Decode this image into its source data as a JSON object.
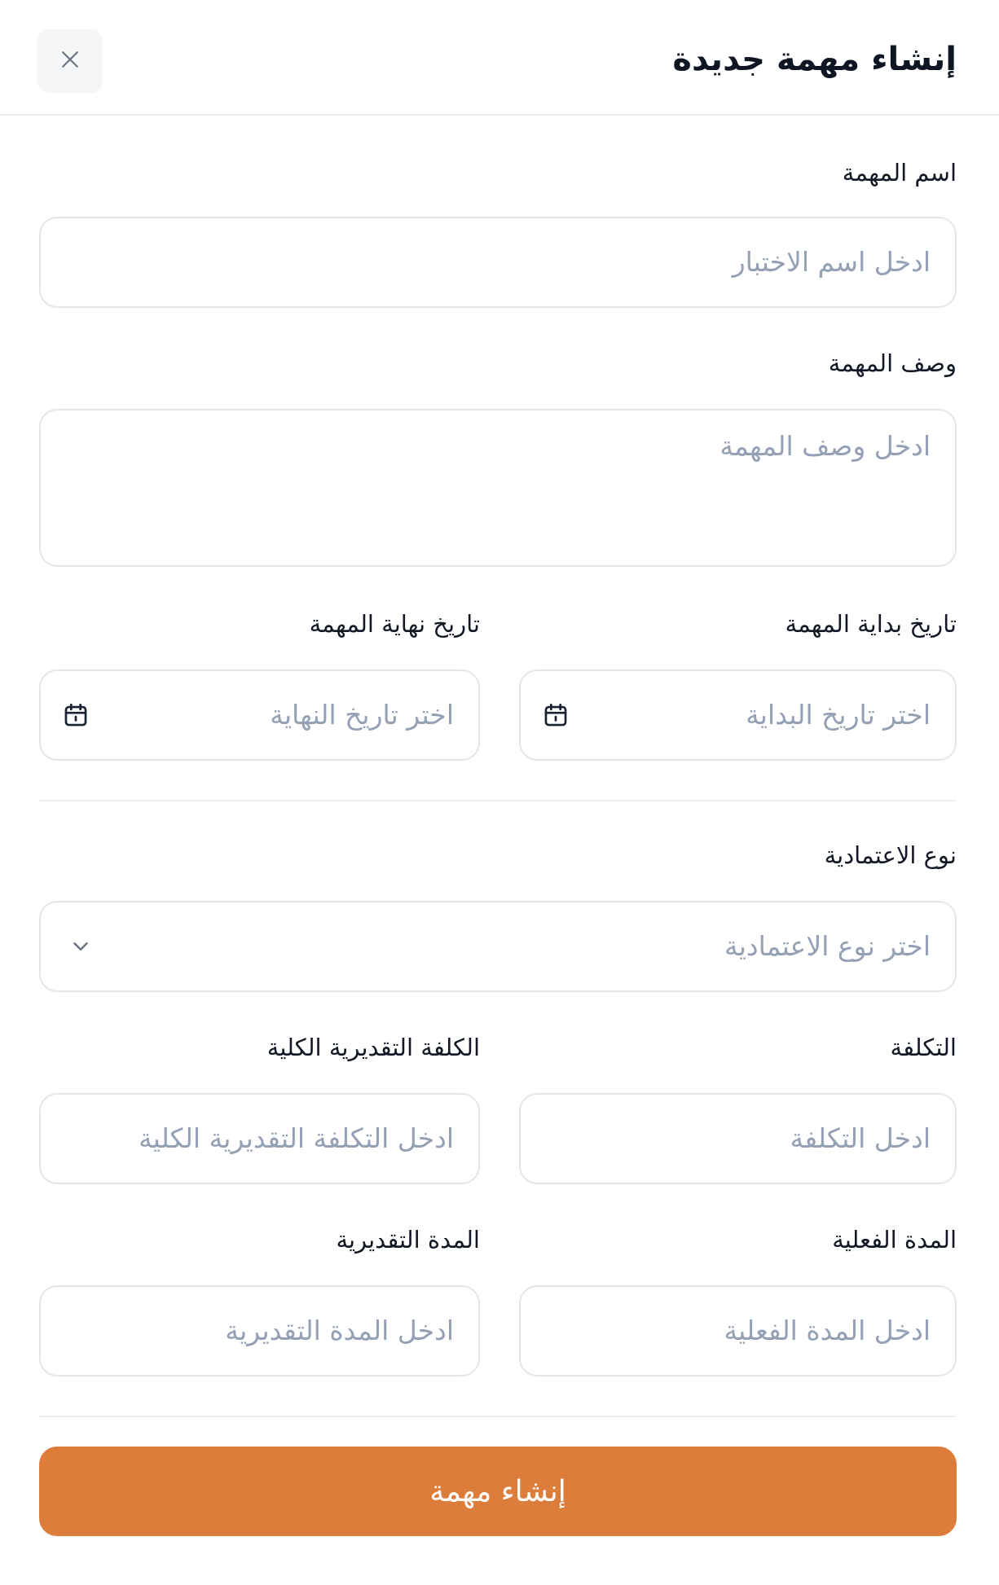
{
  "header": {
    "title": "إنشاء مهمة جديدة",
    "close_icon": "close-icon"
  },
  "form": {
    "task_name": {
      "label": "اسم المهمة",
      "placeholder": "ادخل اسم الاختبار"
    },
    "task_description": {
      "label": "وصف المهمة",
      "placeholder": "ادخل وصف المهمة"
    },
    "start_date": {
      "label": "تاريخ بداية المهمة",
      "placeholder": "اختر تاريخ البداية",
      "icon": "calendar-icon"
    },
    "end_date": {
      "label": "تاريخ نهاية المهمة",
      "placeholder": "اختر تاريخ النهاية",
      "icon": "calendar-icon"
    },
    "approval_type": {
      "label": "نوع الاعتمادية",
      "placeholder": "اختر نوع الاعتمادية",
      "icon": "chevron-down-icon"
    },
    "cost": {
      "label": "التكلفة",
      "placeholder": "ادخل التكلفة"
    },
    "estimated_total_cost": {
      "label": "الكلفة التقديرية الكلية",
      "placeholder": "ادخل التكلفة التقديرية الكلية"
    },
    "actual_duration": {
      "label": "المدة الفعلية",
      "placeholder": "ادخل المدة الفعلية"
    },
    "estimated_duration": {
      "label": "المدة التقديرية",
      "placeholder": "ادخل المدة التقديرية"
    }
  },
  "actions": {
    "submit_label": "إنشاء مهمة"
  },
  "colors": {
    "accent": "#dd7d3c",
    "placeholder": "#94a0b4",
    "border": "#e3e6ec"
  }
}
